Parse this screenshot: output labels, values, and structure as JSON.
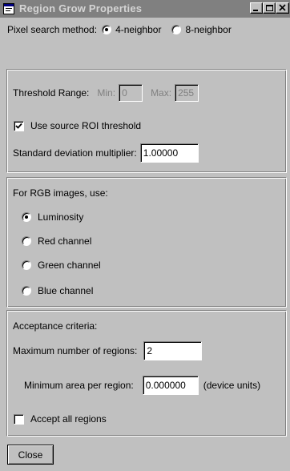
{
  "window": {
    "title": "Region Grow Properties"
  },
  "pixel_search": {
    "label": "Pixel search method:",
    "option_4": "4-neighbor",
    "option_8": "8-neighbor",
    "selected": "4-neighbor"
  },
  "threshold": {
    "label": "Threshold Range:",
    "min_label": "Min:",
    "min_value": "0",
    "max_label": "Max:",
    "max_value": "255",
    "use_source_roi_label": "Use source ROI threshold",
    "use_source_roi_checked": true,
    "std_dev_label": "Standard deviation multiplier:",
    "std_dev_value": "1.00000"
  },
  "rgb": {
    "label": "For RGB images, use:",
    "options": [
      "Luminosity",
      "Red channel",
      "Green channel",
      "Blue channel"
    ],
    "selected": "Luminosity"
  },
  "acceptance": {
    "label": "Acceptance criteria:",
    "max_regions_label": "Maximum number of regions:",
    "max_regions_value": "2",
    "min_area_label": "Minimum area per region:",
    "min_area_value": "0.000000",
    "min_area_units": "(device units)",
    "accept_all_label": "Accept all regions",
    "accept_all_checked": false
  },
  "buttons": {
    "close_label": "Close"
  }
}
